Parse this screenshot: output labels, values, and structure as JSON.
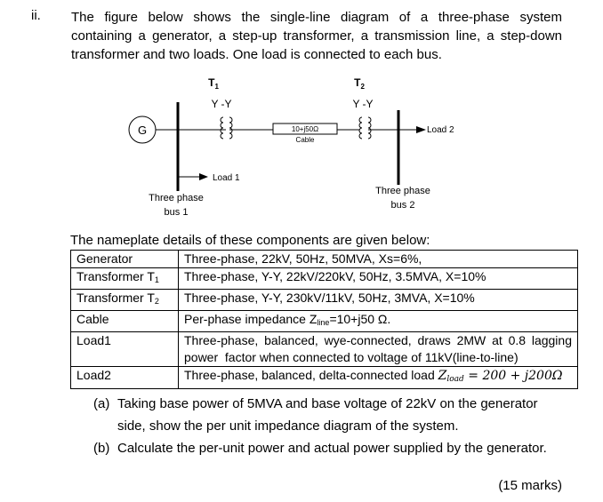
{
  "question": {
    "number": "ii.",
    "intro_lines": [
      "The figure below shows the single-line diagram of a three-phase system",
      "containing a generator, a step-up transformer, a transmission line, a step-down",
      "transformer and two loads. One load is connected to each bus."
    ]
  },
  "diagram": {
    "generator_label": "G",
    "t1": {
      "name": "T",
      "sub": "1",
      "connection": "Y -Y"
    },
    "t2": {
      "name": "T",
      "sub": "2",
      "connection": "Y -Y"
    },
    "cable": {
      "impedance": "10+j50Ω",
      "label": "Cable"
    },
    "load1_label": "Load 1",
    "load2_label": "Load 2",
    "bus1": {
      "line1": "Three phase",
      "line2": "bus 1"
    },
    "bus2": {
      "line1": "Three phase",
      "line2": "bus 2"
    }
  },
  "nameplate": {
    "title": "The nameplate details of these components are given below:",
    "rows": [
      {
        "component": "Generator",
        "details": "Three-phase, 22kV, 50Hz, 50MVA, Xs=6%,"
      },
      {
        "component": "Transformer T",
        "component_sub": "1",
        "details": "Three-phase, Y-Y, 22kV/220kV, 50Hz, 3.5MVA, X=10%"
      },
      {
        "component": "Transformer T",
        "component_sub": "2",
        "details": "Three-phase, Y-Y, 230kV/11kV, 50Hz, 3MVA, X=10%"
      },
      {
        "component": "Cable",
        "details_pre": "Per-phase impedance Z",
        "details_sub": "line",
        "details_post": "=10+j50 Ω."
      },
      {
        "component": "Load1",
        "details_line1": "Three-phase, balanced, wye-connected, draws 2MW at 0.8 lagging",
        "details_line2": "power  factor when connected to voltage of 11kV(line-to-line)"
      },
      {
        "component": "Load2",
        "details_pre": "Three-phase, balanced, delta-connected load ",
        "details_math": "Z",
        "details_math_sub": "load",
        "details_post": " = 200 + j200Ω"
      }
    ]
  },
  "parts": [
    {
      "label": "(a)",
      "text": "Taking base power of 5MVA and base voltage of 22kV on the generator side, show the per unit impedance diagram of the system."
    },
    {
      "label": "(b)",
      "text": "Calculate the per-unit power and actual power supplied by the generator."
    }
  ],
  "marks": "(15 marks)"
}
